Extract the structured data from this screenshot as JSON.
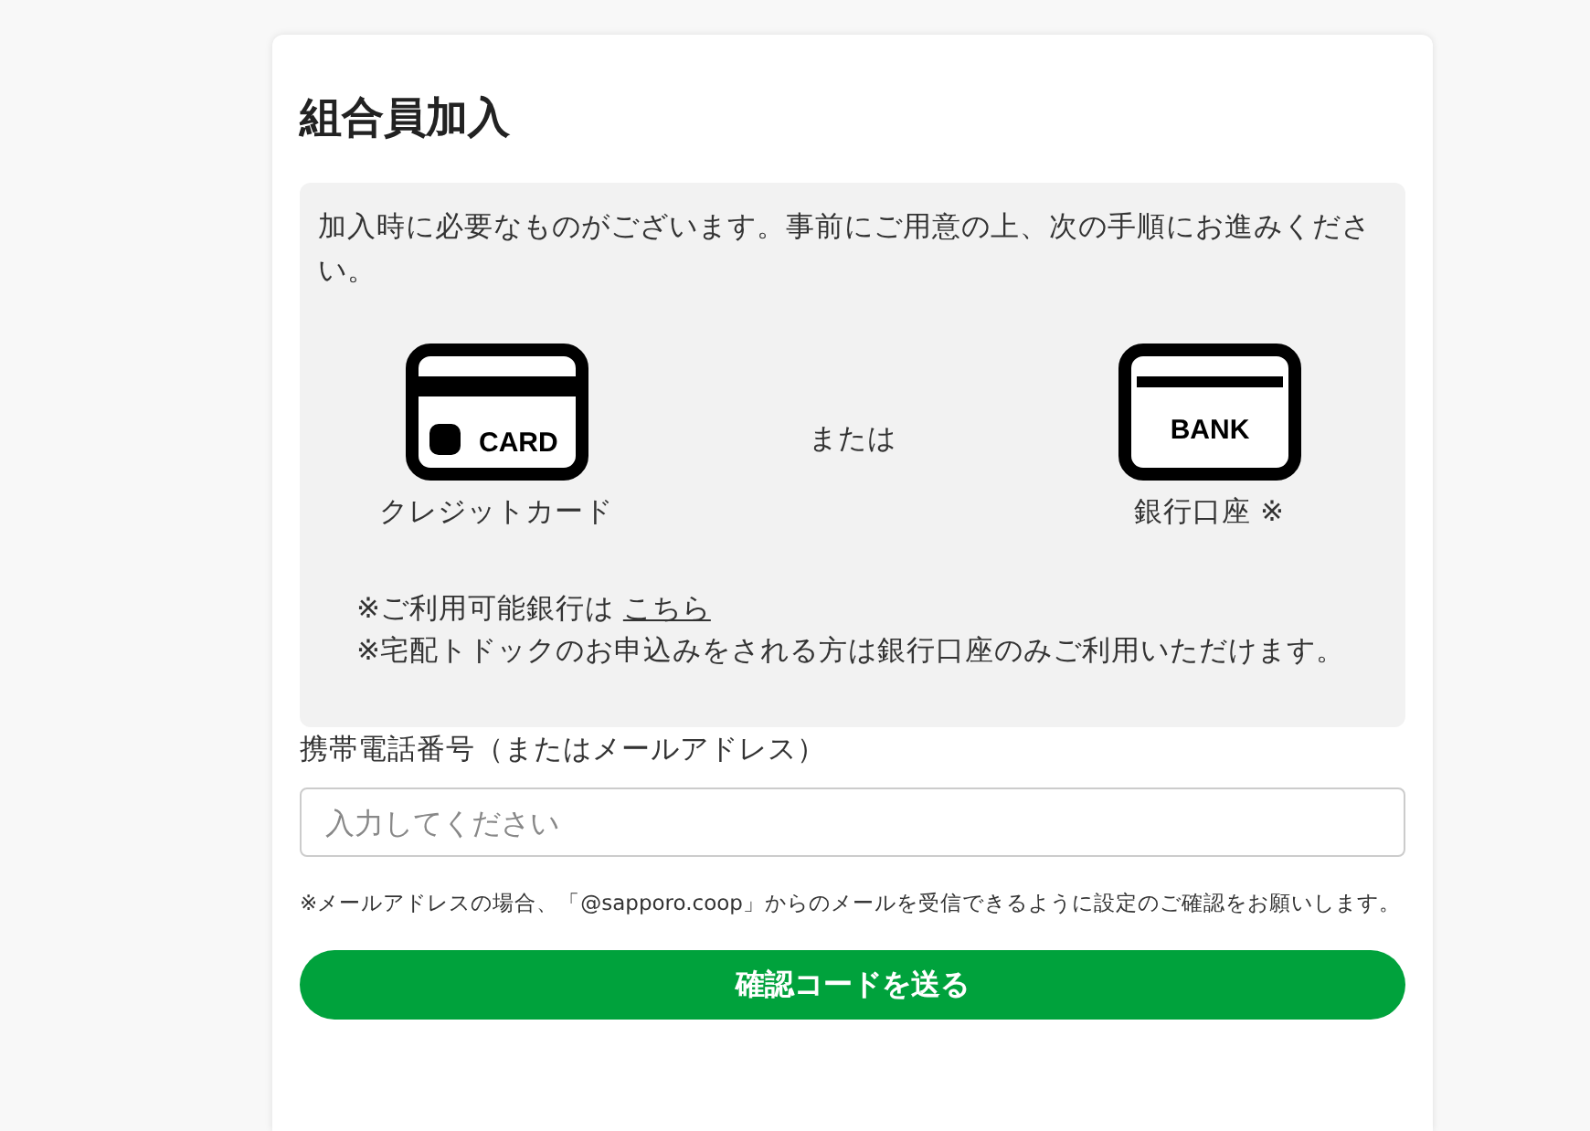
{
  "title": "組合員加入",
  "info": {
    "intro": "加入時に必要なものがございます。事前にご用意の上、次の手順にお進みください。",
    "options": [
      {
        "kind": "card",
        "icon_text": "CARD",
        "label": "クレジットカード"
      },
      {
        "kind": "separator",
        "label": "または"
      },
      {
        "kind": "bank",
        "icon_text": "BANK",
        "label": "銀行口座 ※"
      }
    ],
    "notes": [
      {
        "text": "※ご利用可能銀行は",
        "link": "こちら"
      },
      {
        "text": "※宅配トドックのお申込みをされる方は銀行口座のみご利用いただけます。"
      }
    ]
  },
  "phone": {
    "label": "携帯電話番号（またはメールアドレス）",
    "placeholder": "入力してください",
    "note": "※メールアドレスの場合、「@sapporo.coop」からのメールを受信できるように設定のご確認をお願いします。"
  },
  "submit_button": "確認コードを送る"
}
